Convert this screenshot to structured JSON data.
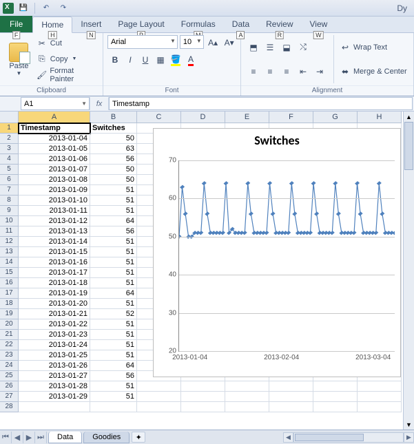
{
  "titlebar": {
    "right_text": "Dy"
  },
  "qat": {
    "items": [
      "save",
      "undo",
      "redo"
    ]
  },
  "tabs": {
    "file": {
      "label": "File",
      "key": "F"
    },
    "list": [
      {
        "label": "Home",
        "key": "H",
        "active": true
      },
      {
        "label": "Insert",
        "key": "N"
      },
      {
        "label": "Page Layout",
        "key": "P"
      },
      {
        "label": "Formulas",
        "key": "M"
      },
      {
        "label": "Data",
        "key": "A"
      },
      {
        "label": "Review",
        "key": "R"
      },
      {
        "label": "View",
        "key": "W"
      }
    ]
  },
  "ribbon": {
    "clipboard": {
      "paste": "Paste",
      "cut": "Cut",
      "copy": "Copy",
      "format_painter": "Format Painter",
      "label": "Clipboard"
    },
    "font": {
      "name": "Arial",
      "size": "10",
      "label": "Font"
    },
    "alignment": {
      "wrap": "Wrap Text",
      "merge": "Merge & Center",
      "label": "Alignment"
    }
  },
  "formula_bar": {
    "cell_ref": "A1",
    "fx": "fx",
    "value": "Timestamp"
  },
  "columns": [
    "A",
    "B",
    "C",
    "D",
    "E",
    "F",
    "G",
    "H"
  ],
  "headers": {
    "A": "Timestamp",
    "B": "Switches"
  },
  "rows": [
    {
      "ts": "2013-01-04",
      "v": 50
    },
    {
      "ts": "2013-01-05",
      "v": 63
    },
    {
      "ts": "2013-01-06",
      "v": 56
    },
    {
      "ts": "2013-01-07",
      "v": 50
    },
    {
      "ts": "2013-01-08",
      "v": 50
    },
    {
      "ts": "2013-01-09",
      "v": 51
    },
    {
      "ts": "2013-01-10",
      "v": 51
    },
    {
      "ts": "2013-01-11",
      "v": 51
    },
    {
      "ts": "2013-01-12",
      "v": 64
    },
    {
      "ts": "2013-01-13",
      "v": 56
    },
    {
      "ts": "2013-01-14",
      "v": 51
    },
    {
      "ts": "2013-01-15",
      "v": 51
    },
    {
      "ts": "2013-01-16",
      "v": 51
    },
    {
      "ts": "2013-01-17",
      "v": 51
    },
    {
      "ts": "2013-01-18",
      "v": 51
    },
    {
      "ts": "2013-01-19",
      "v": 64
    },
    {
      "ts": "2013-01-20",
      "v": 51
    },
    {
      "ts": "2013-01-21",
      "v": 52
    },
    {
      "ts": "2013-01-22",
      "v": 51
    },
    {
      "ts": "2013-01-23",
      "v": 51
    },
    {
      "ts": "2013-01-24",
      "v": 51
    },
    {
      "ts": "2013-01-25",
      "v": 51
    },
    {
      "ts": "2013-01-26",
      "v": 64
    },
    {
      "ts": "2013-01-27",
      "v": 56
    },
    {
      "ts": "2013-01-28",
      "v": 51
    },
    {
      "ts": "2013-01-29",
      "v": 51
    }
  ],
  "chart_data": {
    "type": "line",
    "title": "Switches",
    "ylim": [
      20,
      70
    ],
    "yticks": [
      20,
      30,
      40,
      50,
      60,
      70
    ],
    "xticks": [
      "2013-01-04",
      "2013-02-04",
      "2013-03-04"
    ],
    "x_count_visible": 70,
    "series": [
      {
        "name": "Switches",
        "color": "#4f81bd",
        "values": [
          50,
          63,
          56,
          50,
          50,
          51,
          51,
          51,
          64,
          56,
          51,
          51,
          51,
          51,
          51,
          64,
          51,
          52,
          51,
          51,
          51,
          51,
          64,
          56,
          51,
          51,
          51,
          51,
          51,
          64,
          56,
          51,
          51,
          51,
          51,
          51,
          64,
          56,
          51,
          51,
          51,
          51,
          51,
          64,
          56,
          51,
          51,
          51,
          51,
          51,
          64,
          56,
          51,
          51,
          51,
          51,
          51,
          64,
          56,
          51,
          51,
          51,
          51,
          51,
          64,
          56,
          51,
          51,
          51,
          51
        ]
      }
    ]
  },
  "sheets": {
    "active": "Data",
    "list": [
      "Data",
      "Goodies"
    ]
  },
  "selected_cell": "A1"
}
